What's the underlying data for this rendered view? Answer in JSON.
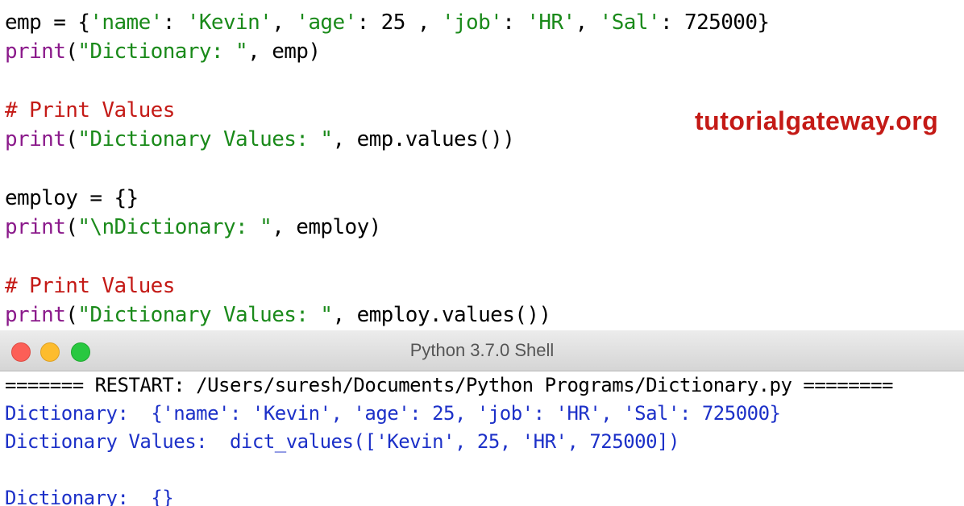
{
  "editor": {
    "lines": [
      {
        "parts": [
          [
            "plain",
            "emp = {"
          ],
          [
            "str",
            "'name'"
          ],
          [
            "plain",
            ": "
          ],
          [
            "str",
            "'Kevin'"
          ],
          [
            "plain",
            ", "
          ],
          [
            "str",
            "'age'"
          ],
          [
            "plain",
            ": 25 , "
          ],
          [
            "str",
            "'job'"
          ],
          [
            "plain",
            ": "
          ],
          [
            "str",
            "'HR'"
          ],
          [
            "plain",
            ", "
          ],
          [
            "str",
            "'Sal'"
          ],
          [
            "plain",
            ": 725000}"
          ]
        ]
      },
      {
        "parts": [
          [
            "kw",
            "print"
          ],
          [
            "plain",
            "("
          ],
          [
            "str",
            "\"Dictionary: \""
          ],
          [
            "plain",
            ", emp)"
          ]
        ]
      },
      {
        "parts": []
      },
      {
        "parts": [
          [
            "cm",
            "# Print Values"
          ]
        ]
      },
      {
        "parts": [
          [
            "kw",
            "print"
          ],
          [
            "plain",
            "("
          ],
          [
            "str",
            "\"Dictionary Values: \""
          ],
          [
            "plain",
            ", emp.values())"
          ]
        ]
      },
      {
        "parts": []
      },
      {
        "parts": [
          [
            "plain",
            "employ = {}"
          ]
        ]
      },
      {
        "parts": [
          [
            "kw",
            "print"
          ],
          [
            "plain",
            "("
          ],
          [
            "str",
            "\"\\nDictionary: \""
          ],
          [
            "plain",
            ", employ)"
          ]
        ]
      },
      {
        "parts": []
      },
      {
        "parts": [
          [
            "cm",
            "# Print Values"
          ]
        ]
      },
      {
        "parts": [
          [
            "kw",
            "print"
          ],
          [
            "plain",
            "("
          ],
          [
            "str",
            "\"Dictionary Values: \""
          ],
          [
            "plain",
            ", employ.values())"
          ]
        ]
      }
    ]
  },
  "watermark": "tutorialgateway.org",
  "shell": {
    "title": "Python 3.7.0 Shell",
    "lines": [
      {
        "cls": "restart",
        "text": "======= RESTART: /Users/suresh/Documents/Python Programs/Dictionary.py ========"
      },
      {
        "cls": "out",
        "text": "Dictionary:  {'name': 'Kevin', 'age': 25, 'job': 'HR', 'Sal': 725000}"
      },
      {
        "cls": "out",
        "text": "Dictionary Values:  dict_values(['Kevin', 25, 'HR', 725000])"
      },
      {
        "cls": "out",
        "text": ""
      },
      {
        "cls": "out",
        "text": "Dictionary:  {}"
      }
    ]
  },
  "colors": {
    "string": "#1a8a1a",
    "keyword": "#8b1a8b",
    "comment": "#c41a16",
    "output": "#1c30c8",
    "close": "#fc5f57",
    "minimize": "#fdbc2e",
    "zoom": "#28c840"
  }
}
